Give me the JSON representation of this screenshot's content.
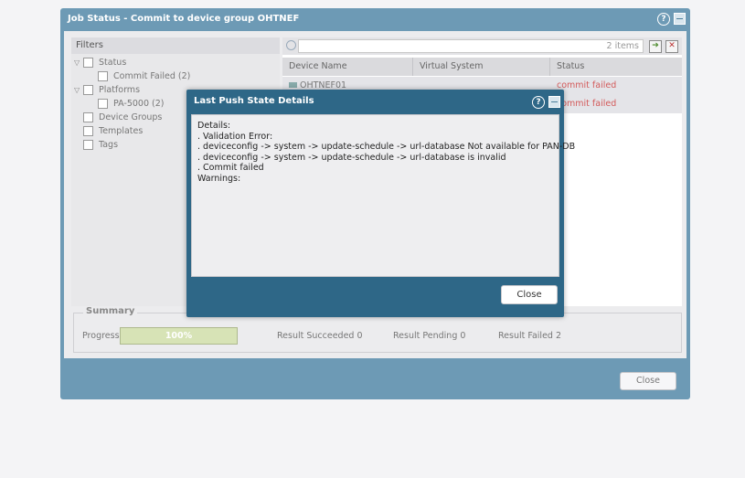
{
  "job_dialog": {
    "title": "Job Status - Commit to device group OHTNEF",
    "filters": {
      "header": "Filters",
      "items": [
        {
          "label": "Status",
          "expander": true
        },
        {
          "label": "Commit Failed (2)",
          "expander": false
        },
        {
          "label": "Platforms",
          "expander": true
        },
        {
          "label": "PA-5000 (2)",
          "expander": false
        },
        {
          "label": "Device Groups",
          "expander": false
        },
        {
          "label": "Templates",
          "expander": false
        },
        {
          "label": "Tags",
          "expander": false
        }
      ]
    },
    "table": {
      "count_text": "2 items",
      "columns": [
        "Device Name",
        "Virtual System",
        "Status"
      ],
      "rows": [
        {
          "device_name": "OHTNEF01",
          "virtual_system": "",
          "status": "commit failed"
        },
        {
          "device_name": "",
          "virtual_system": "",
          "status": "commit failed"
        }
      ]
    },
    "summary": {
      "title": "Summary",
      "progress_label": "Progress",
      "progress_value": "100%",
      "progress_fraction": 1.0,
      "result_succeeded": "Result Succeeded  0",
      "result_pending": "Result Pending  0",
      "result_failed": "Result Failed  2"
    },
    "close_label": "Close"
  },
  "push_state_dialog": {
    "title": "Last Push State Details",
    "lines": [
      "Details:",
      ". Validation Error:",
      ". deviceconfig -> system -> update-schedule -> url-database Not available for PAN-DB",
      ". deviceconfig -> system -> update-schedule -> url-database is invalid",
      ". Commit failed",
      "Warnings:"
    ],
    "close_label": "Close"
  },
  "icons": {
    "help": "help-icon",
    "minimize": "minimize-icon",
    "search": "search-icon",
    "apply_filter": "apply-filter-icon",
    "clear_filter": "clear-filter-icon"
  },
  "colors": {
    "dialog_frame": "#6d9ab5",
    "modal_frame": "#2e6787",
    "failed_status": "#d35a5a",
    "progress_fill": "#d7e3b6"
  }
}
